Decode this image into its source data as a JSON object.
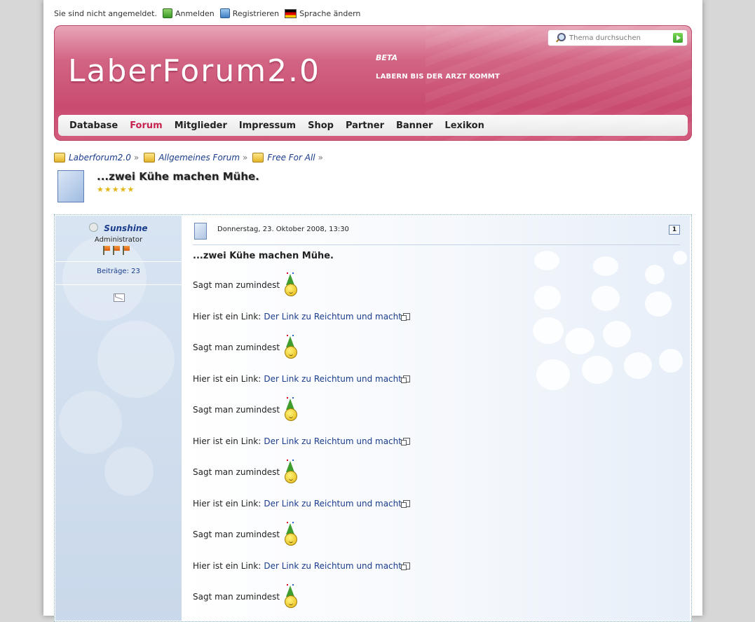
{
  "userbar": {
    "status": "Sie sind nicht angemeldet.",
    "login": "Anmelden",
    "register": "Registrieren",
    "language": "Sprache ändern"
  },
  "header": {
    "logo": "LaberForum2.0",
    "beta": "BETA",
    "slogan": "LABERN BIS DER ARZT KOMMT",
    "search_placeholder": "Thema durchsuchen"
  },
  "nav": {
    "items": [
      "Database",
      "Forum",
      "Mitglieder",
      "Impressum",
      "Shop",
      "Partner",
      "Banner",
      "Lexikon"
    ],
    "active": "Forum"
  },
  "breadcrumb": {
    "items": [
      "Laberforum2.0",
      "Allgemeines Forum",
      "Free For All"
    ],
    "separator": "»"
  },
  "topic": {
    "title": "...zwei Kühe machen Mühe.",
    "rating": 5
  },
  "post": {
    "author": "Sunshine",
    "rank": "Administrator",
    "posts_label": "Beiträge: 23",
    "date": "Donnerstag, 23. Oktober 2008, 13:30",
    "number": "1",
    "subject": "...zwei Kühe machen Mühe.",
    "lines": [
      {
        "type": "text",
        "text": "Sagt man zumindest"
      },
      {
        "type": "link",
        "text": "Hier ist ein Link:",
        "link": "Der Link zu Reichtum und macht"
      },
      {
        "type": "text",
        "text": "Sagt man zumindest"
      },
      {
        "type": "link",
        "text": "Hier ist ein Link:",
        "link": "Der Link zu Reichtum und macht"
      },
      {
        "type": "text",
        "text": "Sagt man zumindest"
      },
      {
        "type": "link",
        "text": "Hier ist ein Link:",
        "link": "Der Link zu Reichtum und macht"
      },
      {
        "type": "text",
        "text": "Sagt man zumindest"
      },
      {
        "type": "link",
        "text": "Hier ist ein Link:",
        "link": "Der Link zu Reichtum und macht"
      },
      {
        "type": "text",
        "text": "Sagt man zumindest"
      },
      {
        "type": "link",
        "text": "Hier ist ein Link:",
        "link": "Der Link zu Reichtum und macht"
      },
      {
        "type": "text",
        "text": "Sagt man zumindest"
      }
    ]
  },
  "colors": {
    "header": "#c94c70",
    "nav_active": "#c8234f",
    "link": "#1a3c8c"
  }
}
